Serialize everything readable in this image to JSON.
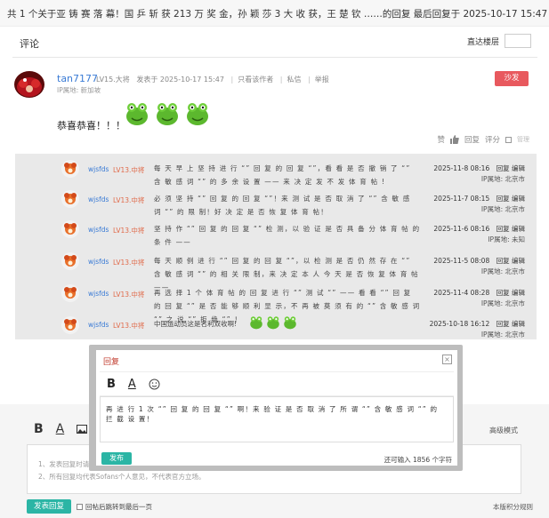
{
  "topbar": {
    "title": "共 1 个关于亚 铸 赛 落 幕！国 乒 斩 获 213 万 奖 金，孙 颖 莎 3 大 收 获，王 楚 钦 ……的回复 最后回复于 2025-10-17 15:47"
  },
  "section": {
    "title": "评论",
    "jump_label": "直达楼层"
  },
  "post": {
    "username": "tan7177",
    "level": "LV15.大将",
    "date": "发表于 2025-10-17 15:47",
    "only_author": "只看该作者",
    "message": "私信",
    "report": "举报",
    "ip": "IP属地: 新加坡",
    "sofa": "沙发",
    "content": "恭喜恭喜！！！",
    "actions": {
      "like": "赞",
      "reply": "回复",
      "rate": "评分",
      "manage": "管理"
    }
  },
  "replies": [
    {
      "user": "wjsfds",
      "level": "LV13.中将",
      "text": "每 天 早 上 坚 持 进 行 “” 回 复 的 回 复 “”，看 看 是 否 撤 销 了 “” 含 敏 感 词 “” 的 多 余 设 置 —— 来 决 定 发 不 发 体 育 帖 !",
      "date": "2025-11-8 08:16",
      "reply": "回复",
      "edit": "编辑",
      "ip": "IP属地: 北京市"
    },
    {
      "user": "wjsfds",
      "level": "LV13.中将",
      "text": "必 须 坚 持 “” 回 复 的 回 复 “”！来 测 试 是 否 取 消 了 “” 含 敏 感 词 “” 的 限 制！好 决 定 是 否 恢 复 体 育 帖！",
      "date": "2025-11-7 08:15",
      "reply": "回复",
      "edit": "编辑",
      "ip": "IP属地: 北京市"
    },
    {
      "user": "wjsfds",
      "level": "LV13.中将",
      "text": "坚 持 作 “” 回 复 的 回 复 “” 检 测，以 验 证 是 否 具 备 分 体 育 帖 的 条 件 ——",
      "date": "2025-11-6 08:16",
      "reply": "回复",
      "edit": "编辑",
      "ip": "IP属地: 未知"
    },
    {
      "user": "wjsfds",
      "level": "LV13.中将",
      "text": "每 天 顺 例 进 行 “” 回 复 的 回 复 “”，以 检 测 是 否 仍 然 存 在 “” 含 敏 感 词 “” 的 相 关 限 制，来 决 定 本 人 今 天 是 否 恢 复 体 育 帖 ——",
      "date": "2025-11-5 08:08",
      "reply": "回复",
      "edit": "编辑",
      "ip": "IP属地: 北京市"
    },
    {
      "user": "wjsfds",
      "level": "LV13.中将",
      "text": "再 选 择 1 个 体 育 帖 的 回 复 进 行 “” 测 试 “” —— 看 看 “” 回 复 的 回 复 “” 是 否 能 够 顺 利 显 示，不 再 被 莫 须 有 的 “” 含 敏 感 词 “” 之 说 “” 拒 绝 “” ！",
      "date": "2025-11-4 08:28",
      "reply": "回复",
      "edit": "编辑",
      "ip": "IP属地: 北京市"
    },
    {
      "user": "wjsfds",
      "level": "LV13.中将",
      "text": "中国运动员这是名利双收啊!",
      "date": "2025-10-18 16:12",
      "reply": "回复",
      "edit": "编辑",
      "ip": "IP属地: 北京市"
    }
  ],
  "modal": {
    "title": "回复",
    "close": "×",
    "text": "再 进 行 1 次 “” 回 复 的 回 复 “” 啊！来 验 证 是 否 取 消 了 所 谓 “” 含 敏 感 词 “” 的 拦 截 设 置！",
    "publish": "发布",
    "count": "还可输入 1856 个字符"
  },
  "editor": {
    "advanced": "高级模式",
    "hint1": "1、发表回复时请",
    "hint2": "2、所有回复均代表Sofans个人意见，不代表官方立场。",
    "publish": "发表回复",
    "back_label": "回帖后跳转到最后一页",
    "rules": "本版积分规则"
  },
  "colors": {
    "accent": "#2bb5a5",
    "sofa": "#e8595e",
    "link": "#3a7bd5",
    "level": "#e06a4a"
  }
}
